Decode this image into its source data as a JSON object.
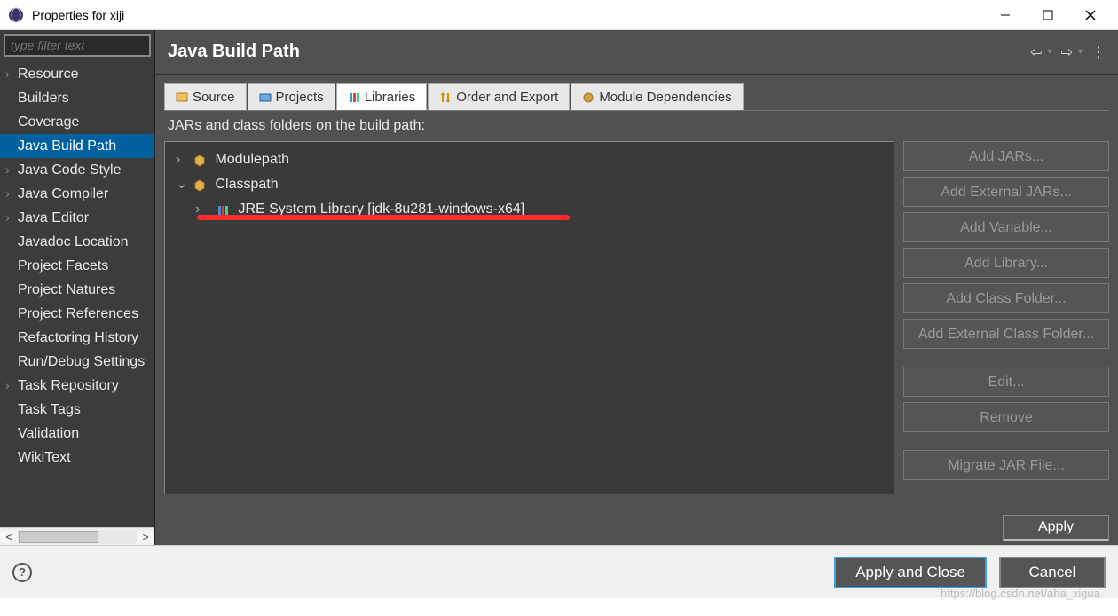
{
  "window": {
    "title": "Properties for xiji"
  },
  "filter": {
    "placeholder": "type filter text"
  },
  "sidebar": {
    "items": [
      {
        "label": "Resource",
        "hasChildren": true,
        "selected": false
      },
      {
        "label": "Builders",
        "hasChildren": false,
        "selected": false
      },
      {
        "label": "Coverage",
        "hasChildren": false,
        "selected": false
      },
      {
        "label": "Java Build Path",
        "hasChildren": false,
        "selected": true
      },
      {
        "label": "Java Code Style",
        "hasChildren": true,
        "selected": false
      },
      {
        "label": "Java Compiler",
        "hasChildren": true,
        "selected": false
      },
      {
        "label": "Java Editor",
        "hasChildren": true,
        "selected": false
      },
      {
        "label": "Javadoc Location",
        "hasChildren": false,
        "selected": false
      },
      {
        "label": "Project Facets",
        "hasChildren": false,
        "selected": false
      },
      {
        "label": "Project Natures",
        "hasChildren": false,
        "selected": false
      },
      {
        "label": "Project References",
        "hasChildren": false,
        "selected": false
      },
      {
        "label": "Refactoring History",
        "hasChildren": false,
        "selected": false
      },
      {
        "label": "Run/Debug Settings",
        "hasChildren": false,
        "selected": false
      },
      {
        "label": "Task Repository",
        "hasChildren": true,
        "selected": false
      },
      {
        "label": "Task Tags",
        "hasChildren": false,
        "selected": false
      },
      {
        "label": "Validation",
        "hasChildren": false,
        "selected": false
      },
      {
        "label": "WikiText",
        "hasChildren": false,
        "selected": false
      }
    ]
  },
  "header": {
    "title": "Java Build Path"
  },
  "tabs": [
    {
      "label": "Source",
      "active": false
    },
    {
      "label": "Projects",
      "active": false
    },
    {
      "label": "Libraries",
      "active": true
    },
    {
      "label": "Order and Export",
      "active": false
    },
    {
      "label": "Module Dependencies",
      "active": false
    }
  ],
  "tabContent": {
    "description": "JARs and class folders on the build path:",
    "tree": [
      {
        "label": "Modulepath",
        "level": 0,
        "expanded": false
      },
      {
        "label": "Classpath",
        "level": 0,
        "expanded": true
      },
      {
        "label": "JRE System Library [jdk-8u281-windows-x64]",
        "level": 1,
        "expanded": false
      }
    ]
  },
  "buttons": {
    "addJars": "Add JARs...",
    "addExternalJars": "Add External JARs...",
    "addVariable": "Add Variable...",
    "addLibrary": "Add Library...",
    "addClassFolder": "Add Class Folder...",
    "addExternalClassFolder": "Add External Class Folder...",
    "edit": "Edit...",
    "remove": "Remove",
    "migrateJar": "Migrate JAR File...",
    "apply": "Apply",
    "applyClose": "Apply and Close",
    "cancel": "Cancel"
  },
  "watermark": "https://blog.csdn.net/aha_xigua"
}
